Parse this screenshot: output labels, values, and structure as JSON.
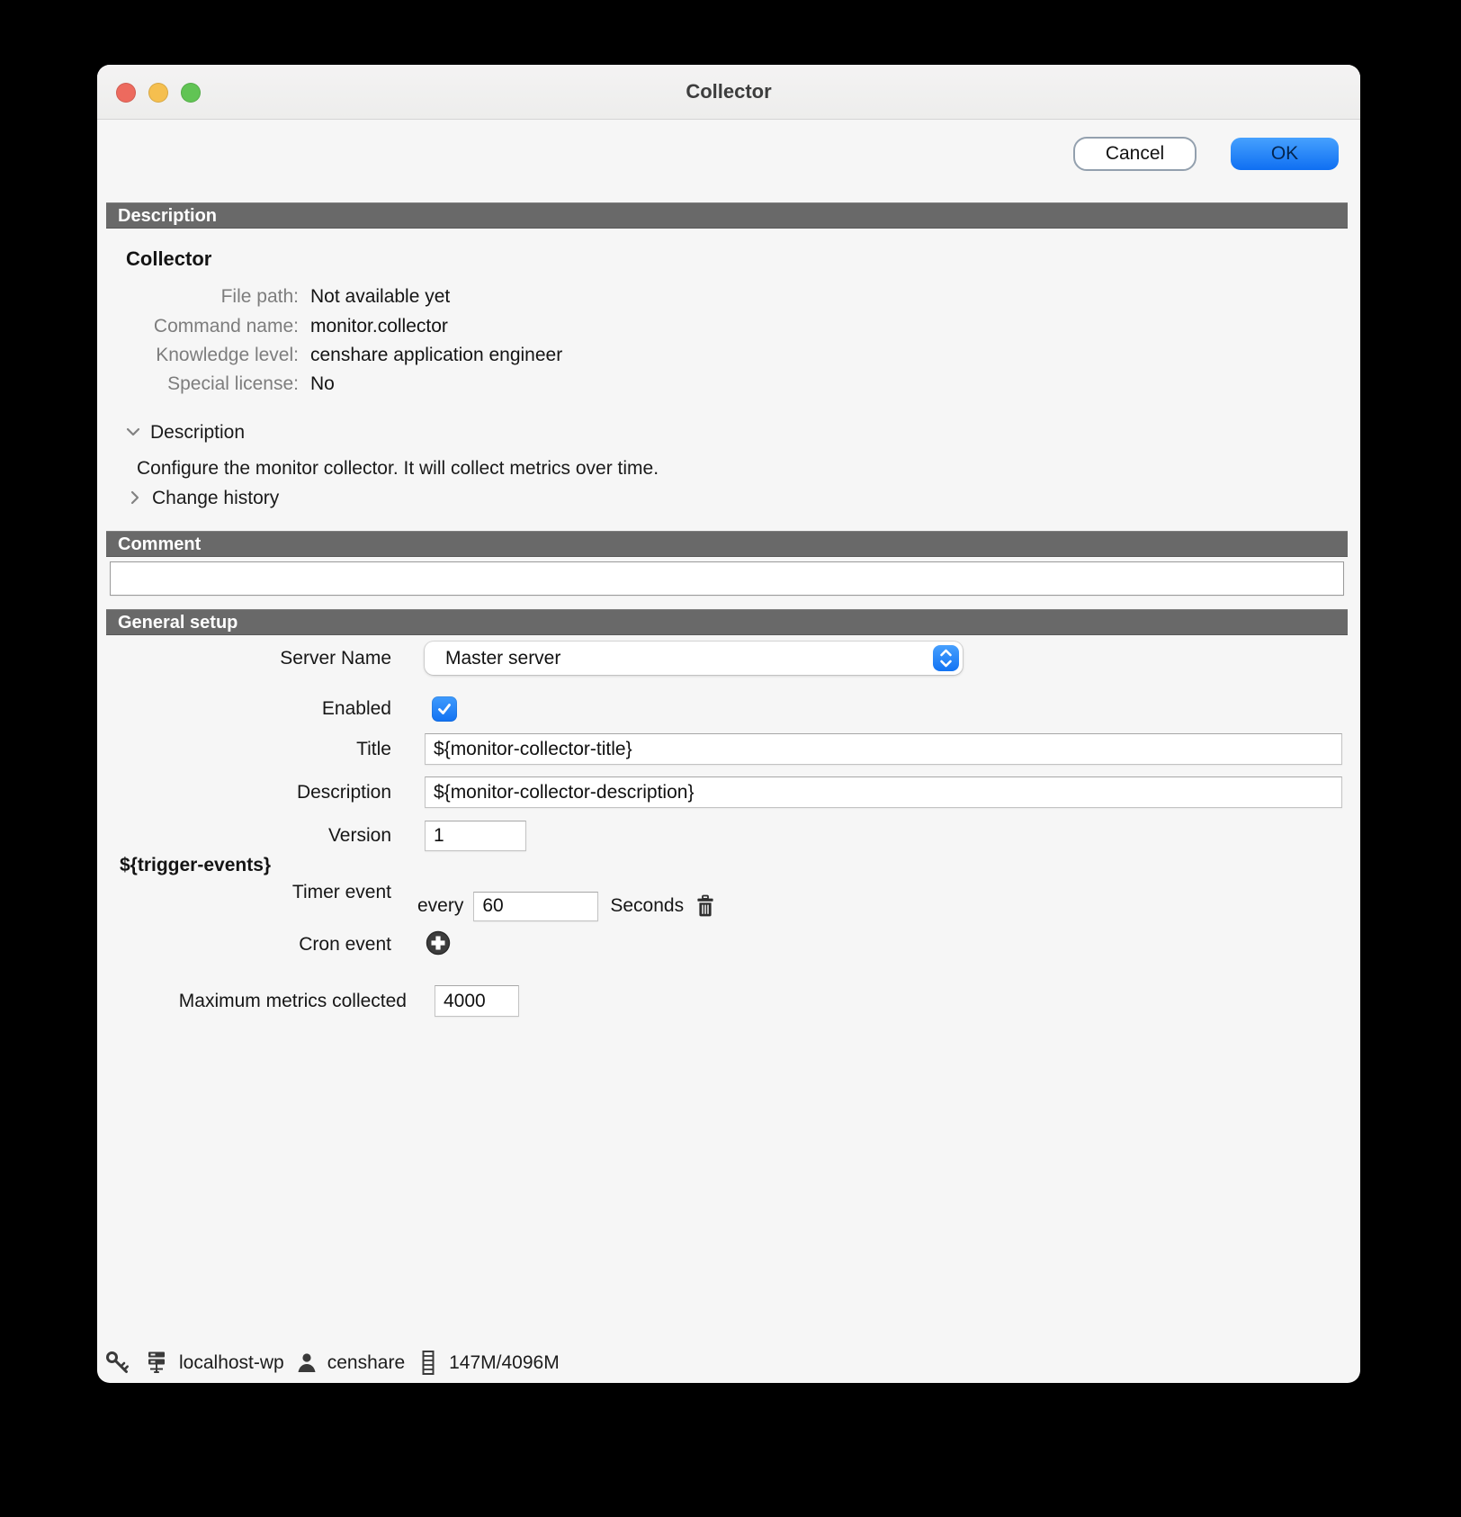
{
  "window": {
    "title": "Collector"
  },
  "toolbar": {
    "cancel_label": "Cancel",
    "ok_label": "OK"
  },
  "sections": {
    "description_header": "Description",
    "comment_header": "Comment",
    "general_setup_header": "General setup"
  },
  "description": {
    "title": "Collector",
    "fields": [
      {
        "label": "File path:",
        "value": "Not available yet"
      },
      {
        "label": "Command name:",
        "value": "monitor.collector"
      },
      {
        "label": "Knowledge level:",
        "value": "censhare application engineer"
      },
      {
        "label": "Special license:",
        "value": "No"
      }
    ],
    "disclosure_description": {
      "label": "Description",
      "expanded": true,
      "content": "Configure the monitor collector. It will collect metrics over time."
    },
    "disclosure_change_history": {
      "label": "Change history",
      "expanded": false
    }
  },
  "comment": {
    "value": ""
  },
  "general_setup": {
    "server_name": {
      "label": "Server Name",
      "value": "Master server"
    },
    "enabled": {
      "label": "Enabled",
      "checked": true
    },
    "title": {
      "label": "Title",
      "value": "${monitor-collector-title}"
    },
    "description": {
      "label": "Description",
      "value": "${monitor-collector-description}"
    },
    "version": {
      "label": "Version",
      "value": "1"
    },
    "trigger_events_label": "${trigger-events}",
    "timer_event": {
      "label": "Timer event",
      "prefix": "every",
      "value": "60",
      "suffix": "Seconds"
    },
    "cron_event": {
      "label": "Cron event"
    },
    "max_metrics": {
      "label": "Maximum metrics collected",
      "value": "4000"
    }
  },
  "status_bar": {
    "host": "localhost-wp",
    "user": "censhare",
    "memory": "147M/4096M"
  },
  "colors": {
    "accent_blue": "#1777f2",
    "section_bar": "#696969",
    "window_bg": "#f6f6f6",
    "traffic_red": "#ed6a5e",
    "traffic_yellow": "#f5bf4f",
    "traffic_green": "#61c454"
  }
}
